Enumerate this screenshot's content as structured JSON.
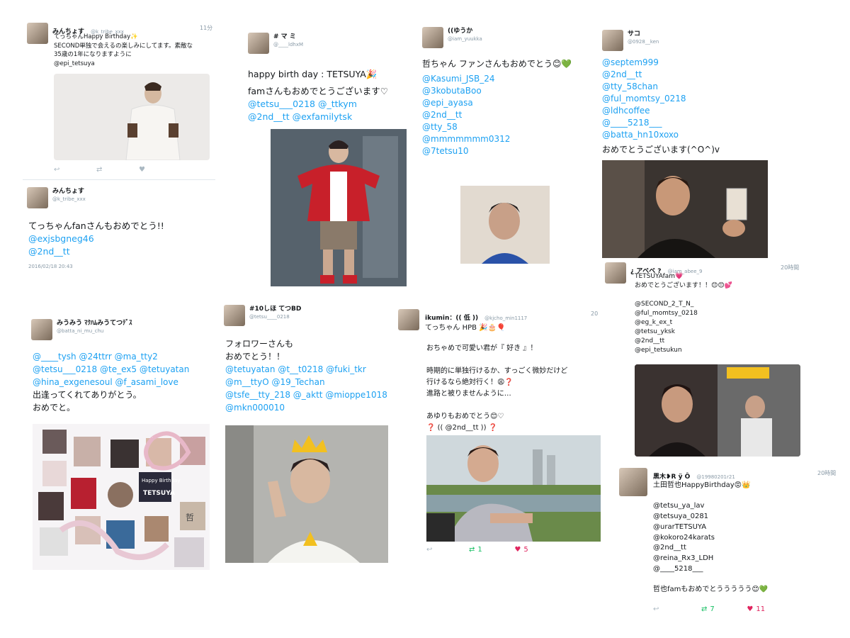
{
  "tweets": {
    "t1": {
      "name": "みんちょす",
      "handle": "@k_tribe_xxx",
      "time": "11分",
      "lines": [
        "てっちゃんHappy Birthday✨",
        "SECOND単独で会えるの楽しみにしてます。素敵な",
        "35歳の1年になりますように",
        "@epi_tetsuya"
      ]
    },
    "t2": {
      "name": "みんちょす",
      "handle": "@k_tribe_xxx",
      "text": "てっちゃんfanさんもおめでとう!!",
      "mentions": [
        "@exjsbgneg46",
        "@2nd__tt"
      ],
      "date": "2016/02/18 20:43"
    },
    "t3": {
      "name": "# マ ミ",
      "handle": "@____ldhxM",
      "text1": "happy birth day : TETSUYA🎉",
      "text2": "famさんもおめでとうございます♡",
      "mention_line1": "@tetsu___0218 @_ttkym",
      "mention_line2": "@2nd__tt @exfamilytsk"
    },
    "t4": {
      "name": "((ゆうか",
      "handle": "@iam_yuukka",
      "text": "哲ちゃん ファンさんもおめでとう😊💚",
      "mentions": [
        "@Kasumi_JSB_24",
        "@3kobutaBoo",
        "@epi_ayasa",
        "@2nd__tt",
        "@tty_58",
        "@mmmmmmm0312",
        "@7tetsu10"
      ]
    },
    "t5": {
      "name": "サコ",
      "handle": "@0928__ken",
      "mentions": [
        "@septem999",
        "@2nd__tt",
        "@tty_58chan",
        "@ful_momtsy_0218",
        "@ldhcoffee",
        "@____5218___",
        "@batta_hn10xoxo"
      ],
      "text": "おめでとうございます(^O^)v"
    },
    "t6": {
      "name": "¿ アベベ ?",
      "handle": "@iam_abee_9",
      "time": "20時間",
      "lines": [
        "TETSUYAfam💗",
        "おめでとうございます！！😊😊💕",
        "",
        "@SECOND_2_T_N_",
        "@ful_momtsy_0218",
        "@eg_k_ex_t",
        "@tetsu_yksk",
        "@2nd__tt",
        "@epi_tetsukun"
      ]
    },
    "t7": {
      "name": "みうみう ﾏｸﾊﾑみうてつﾃﾞｽ",
      "handle": "@batta_ni_mu_chu",
      "mention_lines": [
        "@____tysh @24ttrr @ma_tty2",
        "@tetsu___0218 @te_ex5 @tetuyatan",
        "@hina_exgenesoul @f_asami_love"
      ],
      "text1": "出逢ってくれてありがとう。",
      "text2": "おめでと。",
      "collage_tags": [
        "Happy Birthday",
        "TETSUYA",
        "哲"
      ]
    },
    "t8": {
      "name": "#10しほ てつBD",
      "handle": "@tetsu____0218",
      "text1": "フォロワーさんも",
      "text2": "おめでとう！！",
      "mention_lines": [
        "@tetuyatan @t__t0218 @fuki_tkr",
        "@m__ttyO @19_Techan",
        "@tsfe__tty_218 @_aktt @mioppe1018",
        "@mkn000010"
      ]
    },
    "t9": {
      "name": "ikumin：(( 低 ))",
      "handle": "@kjcho_min1117",
      "time": "20",
      "line1": "てっちゃん HPB 🎉🎂🎈",
      "lines": [
        "おちゃめで可愛い君が『 好き 』！",
        "",
        "時期的に単独行けるか、すっごく微妙だけど",
        "行けるなら絶対行く！😩❓",
        "進路と被りませんように…",
        "",
        "あゆりもおめでとう😊♡",
        "❓ (( @2nd__tt )) ❓"
      ],
      "retweets": "1",
      "likes": "5"
    },
    "t10": {
      "name": "黒木❥R ÿ Ô",
      "handle": "@19980201r21",
      "time": "20時間",
      "lines": [
        "土田哲也HappyBirthday😡👑",
        "",
        "@tetsu_ya_lav",
        "@tetsuya_0281",
        "@urarTETSUYA",
        "@kokoro24karats",
        "@2nd__tt",
        "@reina_Rx3_LDH",
        "@____5218___",
        "",
        "哲也famもおめでとううううう😊💚"
      ],
      "retweets": "7",
      "likes": "11"
    }
  },
  "colors": {
    "link": "#1da1f2",
    "like": "#e0245e",
    "retweet": "#17bf63",
    "muted": "#8899a6"
  }
}
